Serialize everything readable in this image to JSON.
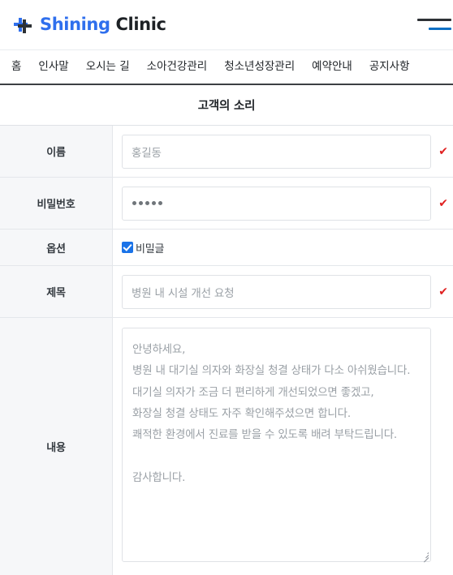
{
  "header": {
    "brand_word1": "Shining",
    "brand_word2": "Clinic",
    "logo_icon": "plus-cross-logo-icon",
    "menu_icon": "hamburger-menu-icon",
    "colors": {
      "brand_blue": "#2f6fed",
      "brand_dark": "#1d2125",
      "menu_accent": "#0d6fc4"
    }
  },
  "nav": {
    "items": [
      {
        "label": "홈"
      },
      {
        "label": "인사말"
      },
      {
        "label": "오시는 길"
      },
      {
        "label": "소아건강관리"
      },
      {
        "label": "청소년성장관리"
      },
      {
        "label": "예약안내"
      },
      {
        "label": "공지사항"
      }
    ]
  },
  "board": {
    "title": "고객의 소리"
  },
  "form": {
    "validated_icon": "red-check-icon",
    "rows": {
      "name": {
        "label": "이름",
        "placeholder": "홍길동",
        "value": "홍길동",
        "valid_mark": "✔"
      },
      "password": {
        "label": "비밀번호",
        "value": "•••••",
        "dot_count": 5,
        "valid_mark": "✔"
      },
      "option": {
        "label": "옵션",
        "checkbox_label": "비밀글",
        "checked": true,
        "checkbox_color": "#1a73e8"
      },
      "subject": {
        "label": "제목",
        "placeholder": "병원 내 시설 개선 요청",
        "value": "병원 내 시설 개선 요청",
        "valid_mark": "✔"
      },
      "content": {
        "label": "내용",
        "value": "안녕하세요,\n병원 내 대기실 의자와 화장실 청결 상태가 다소 아쉬웠습니다.\n대기실 의자가 조금 더 편리하게 개선되었으면 좋겠고,\n화장실 청결 상태도 자주 확인해주셨으면 합니다.\n쾌적한 환경에서 진료를 받을 수 있도록 배려 부탁드립니다.\n\n감사합니다.",
        "resize_icon": "resize-grip-icon"
      }
    }
  }
}
